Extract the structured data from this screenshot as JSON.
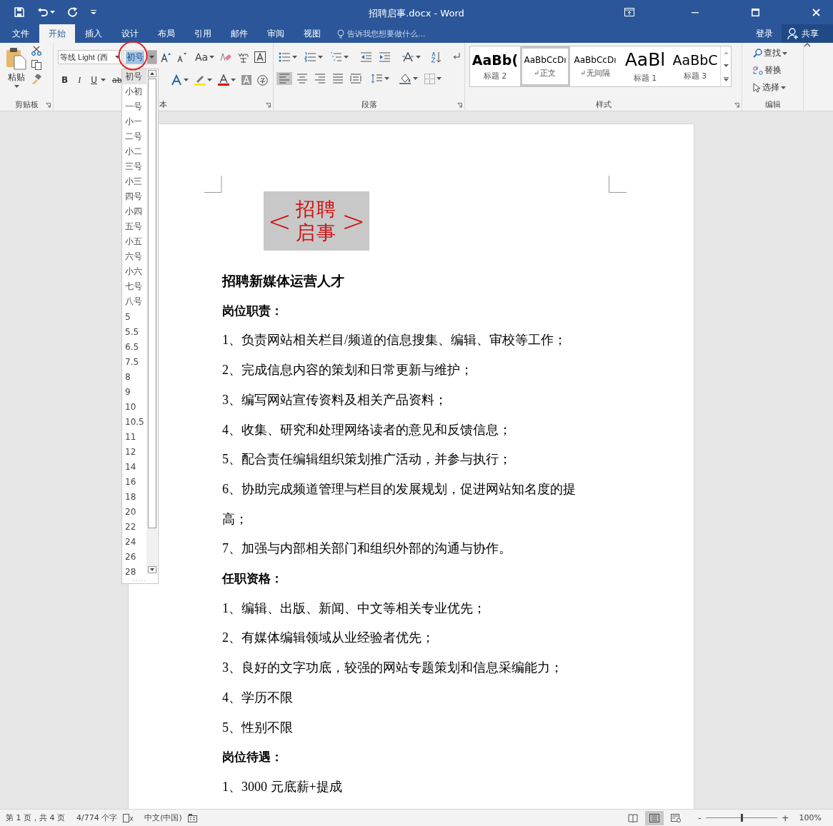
{
  "window": {
    "title": "招聘启事.docx - Word"
  },
  "tabs": [
    {
      "label": "文件",
      "selected": false
    },
    {
      "label": "开始",
      "selected": true
    },
    {
      "label": "插入",
      "selected": false
    },
    {
      "label": "设计",
      "selected": false
    },
    {
      "label": "布局",
      "selected": false
    },
    {
      "label": "引用",
      "selected": false
    },
    {
      "label": "邮件",
      "selected": false
    },
    {
      "label": "审阅",
      "selected": false
    },
    {
      "label": "视图",
      "selected": false
    }
  ],
  "tell_me": {
    "placeholder": "告诉我您想要做什么..."
  },
  "account": {
    "sign_in": "登录",
    "share": "共享"
  },
  "clipboard": {
    "paste": "粘贴",
    "label": "剪贴板"
  },
  "font": {
    "name": "等线 Light (西",
    "size": "初号",
    "case_button": "Aa",
    "bold": "B",
    "italic": "I",
    "underline": "U",
    "strike": "ab",
    "label": "本"
  },
  "paragraph": {
    "label": "段落"
  },
  "styles": {
    "label": "样式",
    "items": [
      {
        "preview": "AaBb(",
        "name": "标题 2",
        "kind": "heading2",
        "paragraph_mark": false,
        "selected": false
      },
      {
        "preview": "AaBbCcDı",
        "name": "正文",
        "kind": "normal",
        "paragraph_mark": true,
        "selected": true
      },
      {
        "preview": "AaBbCcDı",
        "name": "无间隔",
        "kind": "normal",
        "paragraph_mark": true,
        "selected": false
      },
      {
        "preview": "AaBl",
        "name": "标题 1",
        "kind": "heading1",
        "paragraph_mark": false,
        "selected": false
      },
      {
        "preview": "AaBbC",
        "name": "标题 3",
        "kind": "heading3",
        "paragraph_mark": false,
        "selected": false
      }
    ]
  },
  "editing": {
    "label": "编辑",
    "items": [
      {
        "label": "查找",
        "kind": "find",
        "caret": true
      },
      {
        "label": "替换",
        "kind": "replace",
        "caret": false
      },
      {
        "label": "选择",
        "kind": "select",
        "caret": true
      }
    ]
  },
  "size_dropdown": {
    "items": [
      {
        "label": "初号",
        "selected": true
      },
      {
        "label": "小初",
        "selected": false
      },
      {
        "label": "一号",
        "selected": false
      },
      {
        "label": "小一",
        "selected": false
      },
      {
        "label": "二号",
        "selected": false
      },
      {
        "label": "小二",
        "selected": false
      },
      {
        "label": "三号",
        "selected": false
      },
      {
        "label": "小三",
        "selected": false
      },
      {
        "label": "四号",
        "selected": false
      },
      {
        "label": "小四",
        "selected": false
      },
      {
        "label": "五号",
        "selected": false
      },
      {
        "label": "小五",
        "selected": false
      },
      {
        "label": "六号",
        "selected": false
      },
      {
        "label": "小六",
        "selected": false
      },
      {
        "label": "七号",
        "selected": false
      },
      {
        "label": "八号",
        "selected": false
      },
      {
        "label": "5",
        "selected": false
      },
      {
        "label": "5.5",
        "selected": false
      },
      {
        "label": "6.5",
        "selected": false
      },
      {
        "label": "7.5",
        "selected": false
      },
      {
        "label": "8",
        "selected": false
      },
      {
        "label": "9",
        "selected": false
      },
      {
        "label": "10",
        "selected": false
      },
      {
        "label": "10.5",
        "selected": false
      },
      {
        "label": "11",
        "selected": false
      },
      {
        "label": "12",
        "selected": false
      },
      {
        "label": "14",
        "selected": false
      },
      {
        "label": "16",
        "selected": false
      },
      {
        "label": "18",
        "selected": false
      },
      {
        "label": "20",
        "selected": false
      },
      {
        "label": "22",
        "selected": false
      },
      {
        "label": "24",
        "selected": false
      },
      {
        "label": "26",
        "selected": false
      },
      {
        "label": "28",
        "selected": false
      }
    ]
  },
  "document": {
    "banner": {
      "open": "<",
      "title": "招聘启事",
      "close": ">"
    },
    "paragraphs": [
      {
        "kind": "heading",
        "text": "招聘新媒体运营人才"
      },
      {
        "kind": "subheading",
        "text": "岗位职责："
      },
      {
        "kind": "body",
        "text": "1、负责网站相关栏目/频道的信息搜集、编辑、审校等工作；"
      },
      {
        "kind": "body",
        "text": "2、完成信息内容的策划和日常更新与维护；"
      },
      {
        "kind": "body",
        "text": "3、编写网站宣传资料及相关产品资料；"
      },
      {
        "kind": "body",
        "text": "4、收集、研究和处理网络读者的意见和反馈信息；"
      },
      {
        "kind": "body",
        "text": "5、配合责任编辑组织策划推广活动，并参与执行；"
      },
      {
        "kind": "body",
        "text": "6、协助完成频道管理与栏目的发展规划，促进网站知名度的提高；"
      },
      {
        "kind": "body",
        "text": "7、加强与内部相关部门和组织外部的沟通与协作。"
      },
      {
        "kind": "subheading",
        "text": "任职资格："
      },
      {
        "kind": "body",
        "text": "1、编辑、出版、新闻、中文等相关专业优先；"
      },
      {
        "kind": "body",
        "text": "2、有媒体编辑领域从业经验者优先；"
      },
      {
        "kind": "body",
        "text": "3、良好的文字功底，较强的网站专题策划和信息采编能力；"
      },
      {
        "kind": "body",
        "text": "4、学历不限"
      },
      {
        "kind": "body",
        "text": "5、性别不限"
      },
      {
        "kind": "subheading",
        "text": "岗位待遇："
      },
      {
        "kind": "body",
        "text": "1、3000 元底薪+提成"
      }
    ]
  },
  "status_bar": {
    "page": "第 1 页，共 4 页",
    "words": "4/774 个字",
    "language": "中文(中国)",
    "views": [
      {
        "kind": "read",
        "selected": false
      },
      {
        "kind": "print",
        "selected": true
      },
      {
        "kind": "web",
        "selected": false
      }
    ],
    "zoom_out": "-",
    "zoom_in": "+",
    "zoom": {
      "level": 0.5
    },
    "zoom_text": "100%"
  }
}
